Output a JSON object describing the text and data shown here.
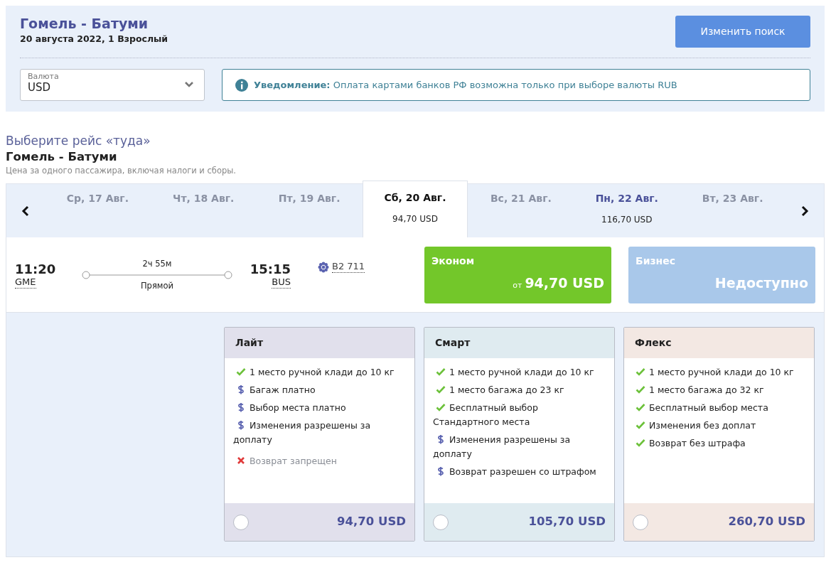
{
  "search": {
    "title": "Гомель - Батуми",
    "subtitle": "20 августа 2022, 1 Взрослый",
    "button": "Изменить поиск",
    "currency": {
      "label": "Валюта",
      "value": "USD"
    },
    "notice": "**Уведомление:** Оплата картами банков РФ возможна только при выборе валюты RUB"
  },
  "section": {
    "heading": "Выберите рейс «туда»",
    "route": "Гомель - Батуми",
    "note": "Цена за одного пассажира, включая налоги и сборы."
  },
  "dates": [
    {
      "label": "Ср, 17 Авг.",
      "selected": false
    },
    {
      "label": "Чт, 18 Авг.",
      "selected": false
    },
    {
      "label": "Пт, 19 Авг.",
      "selected": false
    },
    {
      "label": "Сб, 20 Авг.",
      "price": "94,70 USD",
      "selected": true
    },
    {
      "label": "Вс, 21 Авг.",
      "selected": false
    },
    {
      "label": "Пн, 22 Авг.",
      "price": "116,70 USD",
      "selected": false
    },
    {
      "label": "Вт, 23 Авг.",
      "selected": false
    }
  ],
  "flight": {
    "departure_time": "11:20",
    "departure_code": "GME",
    "duration": "2ч 55м",
    "stops": "Прямой",
    "arrival_time": "15:15",
    "arrival_code": "BUS",
    "flight_number": "B2 711"
  },
  "cabins": [
    {
      "name": "Эконом",
      "available": true,
      "prefix": "от",
      "price": "94,70 USD"
    },
    {
      "name": "Бизнес",
      "available": false,
      "price": "Недоступно"
    }
  ],
  "fares": [
    {
      "name": "Лайт",
      "color": "#e1e0ec",
      "selected": false,
      "price": "94,70 USD",
      "features": [
        {
          "kind": "included",
          "text": "1 место ручной клади до 10 кг"
        },
        {
          "kind": "paid",
          "text": "Багаж платно"
        },
        {
          "kind": "paid",
          "text": "Выбор места платно"
        },
        {
          "kind": "paid",
          "text": "Изменения разрешены за доплату"
        },
        {
          "kind": "forbidden",
          "text": "Возврат запрещен"
        }
      ]
    },
    {
      "name": "Смарт",
      "color": "#dfebf0",
      "selected": false,
      "price": "105,70 USD",
      "features": [
        {
          "kind": "included",
          "text": "1 место ручной клади до 10 кг"
        },
        {
          "kind": "included",
          "text": "1 место багажа до 23 кг"
        },
        {
          "kind": "included",
          "text": "Бесплатный выбор Стандартного места"
        },
        {
          "kind": "paid",
          "text": "Изменения разрешены за доплату"
        },
        {
          "kind": "paid",
          "text": "Возврат разрешен со штрафом"
        }
      ]
    },
    {
      "name": "Флекс",
      "color": "#f3e8e3",
      "selected": false,
      "price": "260,70 USD",
      "features": [
        {
          "kind": "included",
          "text": "1 место ручной клади до 10 кг"
        },
        {
          "kind": "included",
          "text": "1 место багажа до 32 кг"
        },
        {
          "kind": "included",
          "text": "Бесплатный выбор места"
        },
        {
          "kind": "included",
          "text": "Изменения без доплат"
        },
        {
          "kind": "included",
          "text": "Возврат без штрафа"
        }
      ]
    }
  ]
}
